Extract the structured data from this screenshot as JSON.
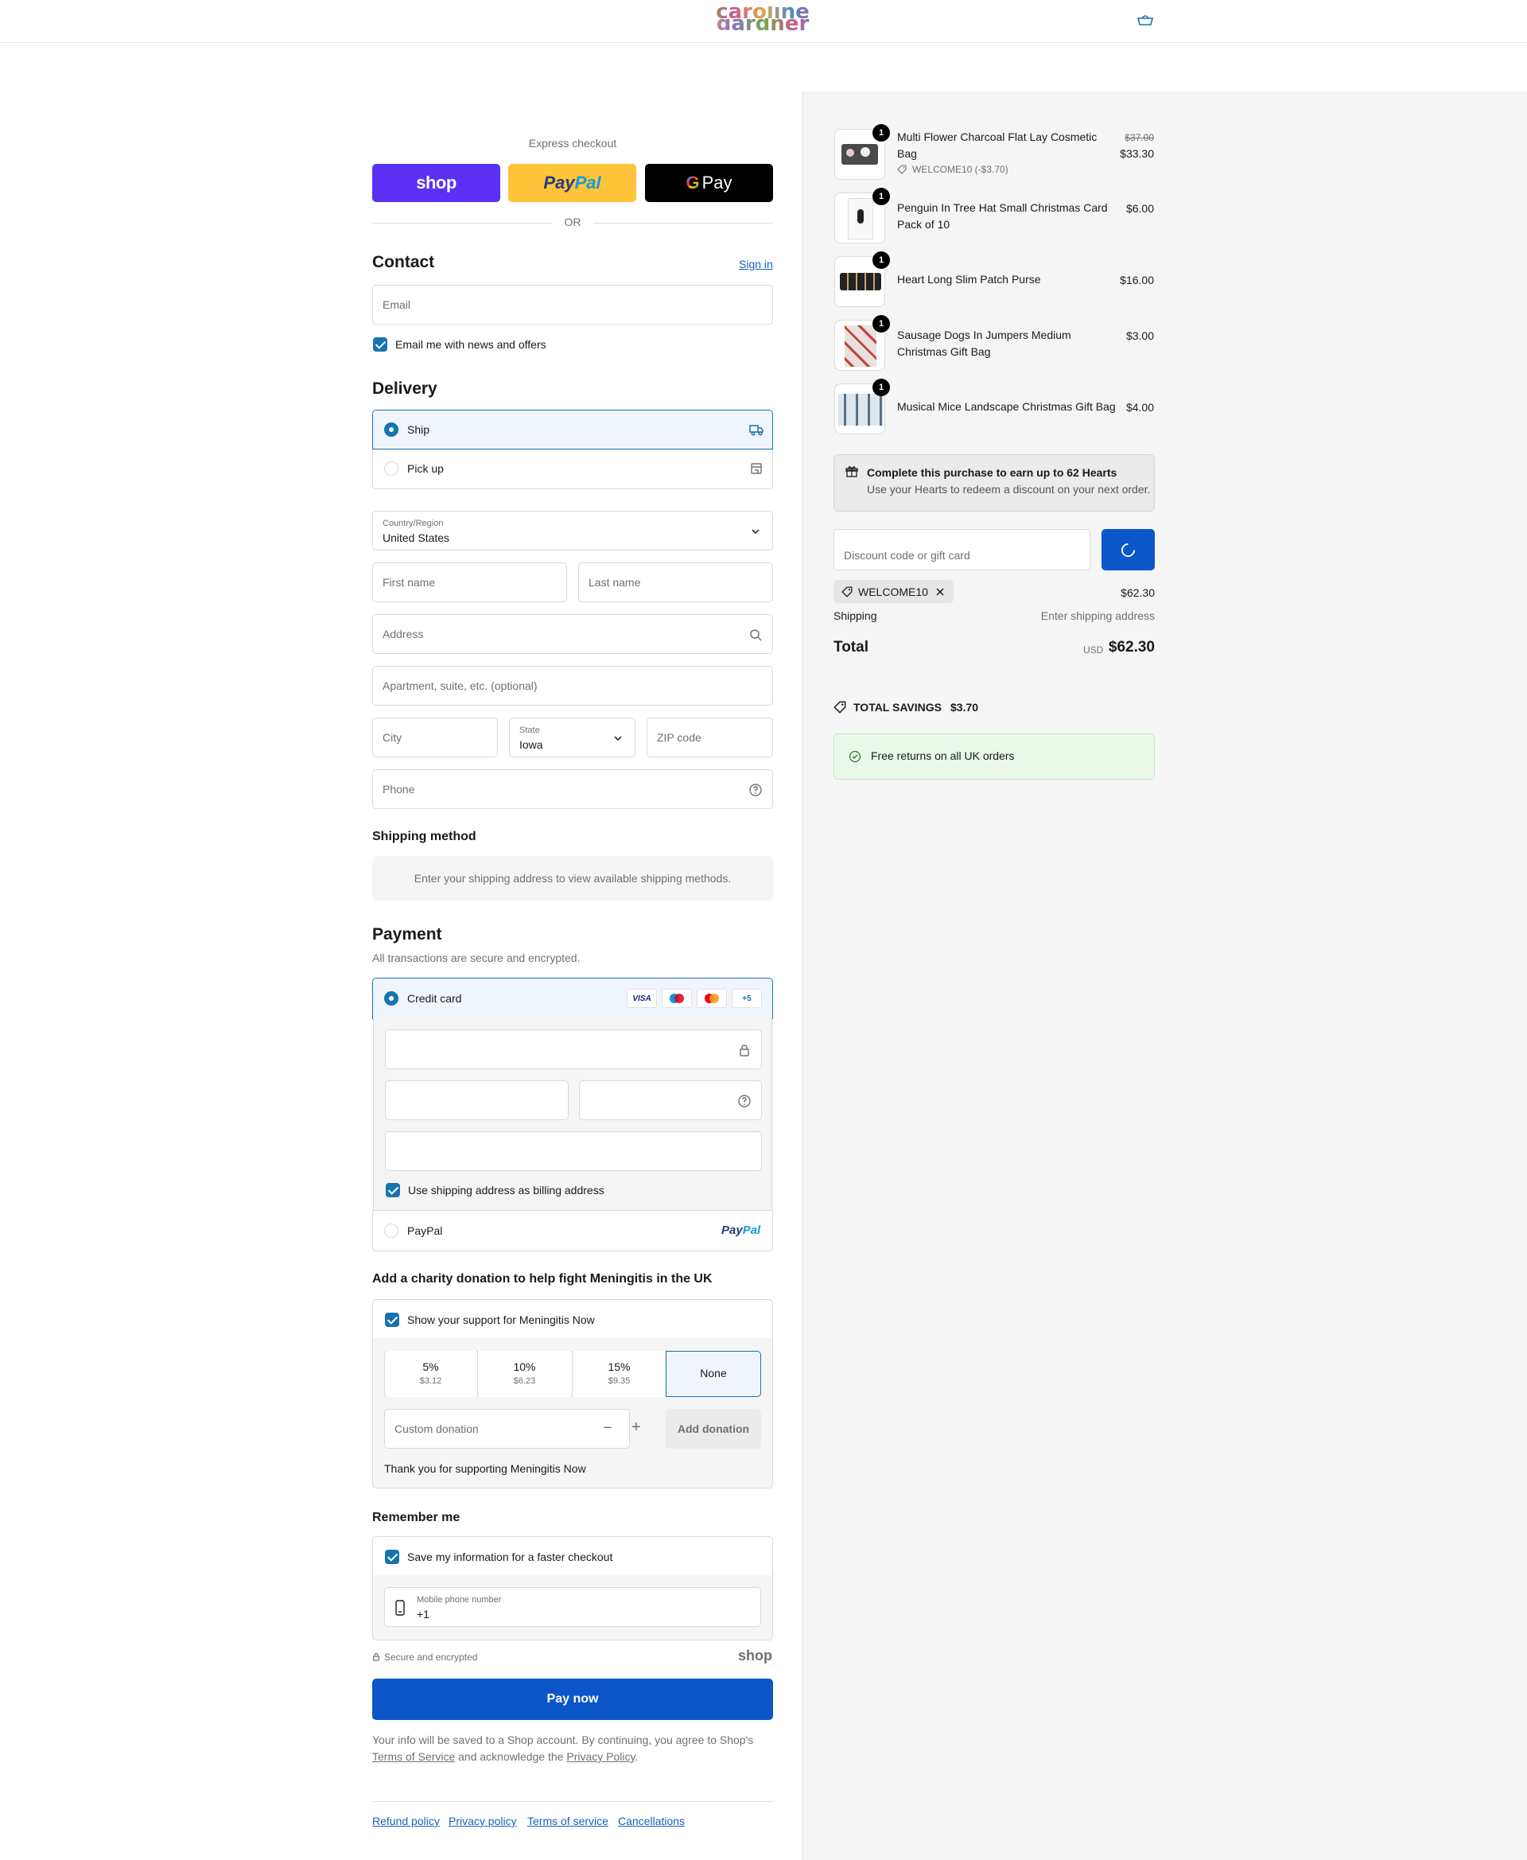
{
  "brand": {
    "logo_line1": "caroline",
    "logo_line2": "gardner"
  },
  "express": {
    "title": "Express checkout",
    "shop_label": "shop",
    "paypal_a": "Pay",
    "paypal_b": "Pal",
    "gpay_label": "Pay",
    "or": "OR"
  },
  "contact": {
    "title": "Contact",
    "signin": "Sign in",
    "email_placeholder": "Email",
    "news_label": "Email me with news and offers"
  },
  "delivery": {
    "title": "Delivery",
    "ship_label": "Ship",
    "pickup_label": "Pick up",
    "country_label": "Country/Region",
    "country_value": "United States",
    "first_name": "First name",
    "last_name": "Last name",
    "address": "Address",
    "apartment": "Apartment, suite, etc. (optional)",
    "city": "City",
    "state_label": "State",
    "state_value": "Iowa",
    "zip": "ZIP code",
    "phone": "Phone"
  },
  "shipping_method": {
    "title": "Shipping method",
    "message": "Enter your shipping address to view available shipping methods."
  },
  "payment": {
    "title": "Payment",
    "subtitle": "All transactions are secure and encrypted.",
    "credit_card": "Credit card",
    "card_visa": "VISA",
    "card_more": "+5",
    "billing_same": "Use shipping address as billing address",
    "paypal": "PayPal",
    "paypal_logo_a": "Pay",
    "paypal_logo_b": "Pal"
  },
  "charity": {
    "title": "Add a charity donation to help fight Meningitis in the UK",
    "support_label": "Show your support for Meningitis Now",
    "options": [
      {
        "pct": "5%",
        "amt": "$3.12"
      },
      {
        "pct": "10%",
        "amt": "$6.23"
      },
      {
        "pct": "15%",
        "amt": "$9.35"
      },
      {
        "pct": "None",
        "amt": ""
      }
    ],
    "custom_placeholder": "Custom donation",
    "minus": "−",
    "plus": "+",
    "add_label": "Add donation",
    "thanks": "Thank you for supporting Meningitis Now"
  },
  "remember": {
    "title": "Remember me",
    "save_label": "Save my information for a faster checkout",
    "mobile_label": "Mobile phone number",
    "mobile_value": "+1",
    "secure": "Secure and encrypted",
    "shop_logo": "shop"
  },
  "pay_now": "Pay now",
  "fine_print": {
    "p1": "Your info will be saved to a Shop account. By continuing, you agree to Shop's",
    "tos": "Terms of Service",
    "p2": "and acknowledge the",
    "privacy": "Privacy Policy",
    "p3": "."
  },
  "footer_links": [
    "Refund policy",
    "Privacy policy",
    "Terms of service",
    "Cancellations"
  ],
  "summary": {
    "items": [
      {
        "qty": "1",
        "name": "Multi Flower Charcoal Flat Lay Cosmetic Bag",
        "original": "$37.00",
        "price": "$33.30",
        "discount": "WELCOME10 (-$3.70)"
      },
      {
        "qty": "1",
        "name": "Penguin In Tree Hat Small Christmas Card Pack of 10",
        "price": "$6.00"
      },
      {
        "qty": "1",
        "name": "Heart Long Slim Patch Purse",
        "price": "$16.00"
      },
      {
        "qty": "1",
        "name": "Sausage Dogs In Jumpers Medium Christmas Gift Bag",
        "price": "$3.00"
      },
      {
        "qty": "1",
        "name": "Musical Mice Landscape Christmas Gift Bag",
        "price": "$4.00"
      }
    ],
    "hearts_title": "Complete this purchase to earn up to 62 Hearts",
    "hearts_sub": "Use your Hearts to redeem a discount on your next order.",
    "discount_placeholder": "Discount code or gift card",
    "applied_code": "WELCOME10",
    "subtotal": "$62.30",
    "shipping_label": "Shipping",
    "shipping_value": "Enter shipping address",
    "total_label": "Total",
    "currency": "USD",
    "total": "$62.30",
    "savings_label": "TOTAL SAVINGS",
    "savings_value": "$3.70",
    "returns": "Free returns on all UK orders"
  },
  "colors": {
    "accent": "#1773b0",
    "pay_button": "#0b56c8",
    "shop_purple": "#5a31f4",
    "paypal_yellow": "#ffc439"
  }
}
